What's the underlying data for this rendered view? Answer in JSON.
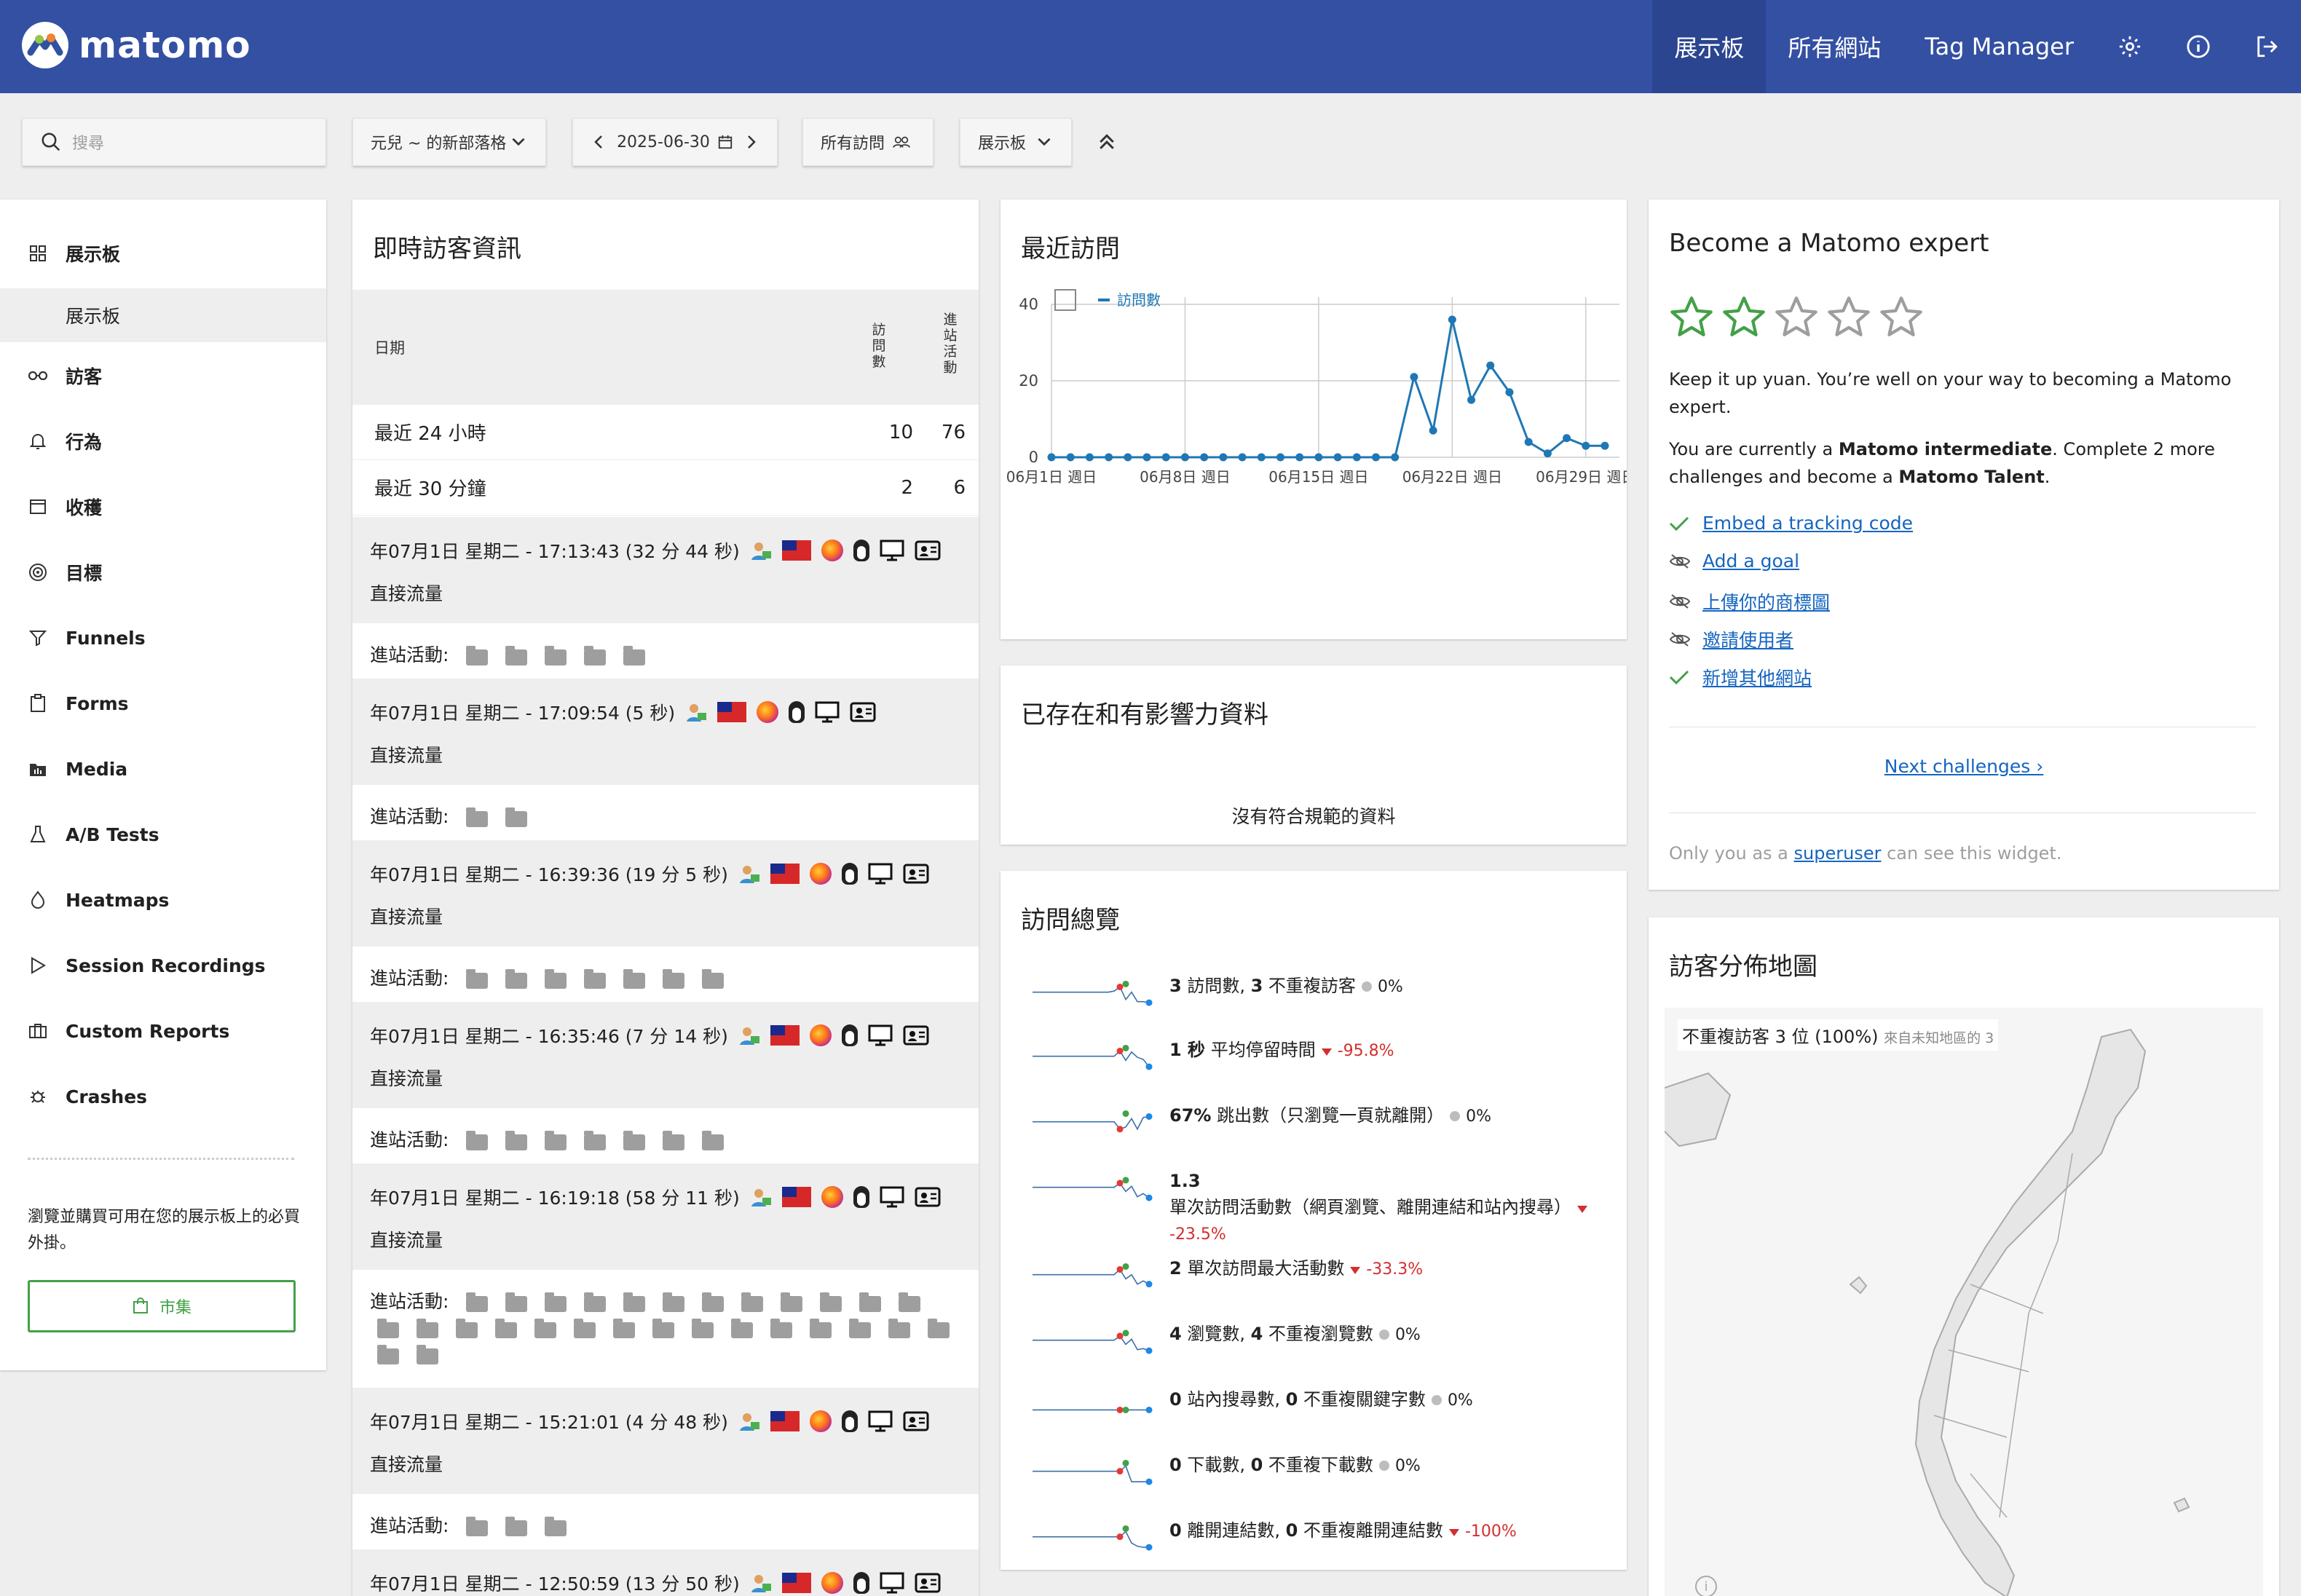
{
  "app": {
    "brand": "matomo"
  },
  "topnav": {
    "dashboard": "展示板",
    "all_websites": "所有網站",
    "tag_manager": "Tag Manager"
  },
  "controls": {
    "search_placeholder": "搜尋",
    "site": "元兒 ~ 的新部落格",
    "date": "2025-06-30",
    "segment": "所有訪問",
    "dashboard": "展示板"
  },
  "sidebar": {
    "items": [
      "展示板",
      "訪客",
      "行為",
      "收穫",
      "目標",
      "Funnels",
      "Forms",
      "Media",
      "A/B Tests",
      "Heatmaps",
      "Session Recordings",
      "Custom Reports",
      "Crashes"
    ],
    "sub": "展示板",
    "promo": "瀏覽並購買可用在您的展示板上的必買外掛。",
    "market": "市集"
  },
  "live": {
    "title": "即時訪客資訊",
    "col_date": "日期",
    "col_visits": "訪問數",
    "col_actions": "進站活動",
    "rows": [
      {
        "label": "最近 24 小時",
        "visits": "10",
        "actions": "76"
      },
      {
        "label": "最近 30 分鐘",
        "visits": "2",
        "actions": "6"
      }
    ],
    "source": "直接流量",
    "actions_label": "進站活動:",
    "visits": [
      {
        "time": "年07月1日 星期二 - 17:13:43 (32 分 44 秒)",
        "folders": 5
      },
      {
        "time": "年07月1日 星期二 - 17:09:54 (5 秒)",
        "folders": 2
      },
      {
        "time": "年07月1日 星期二 - 16:39:36 (19 分 5 秒)",
        "folders": 7
      },
      {
        "time": "年07月1日 星期二 - 16:35:46 (7 分 14 秒)",
        "folders": 7
      },
      {
        "time": "年07月1日 星期二 - 16:19:18 (58 分 11 秒)",
        "folders": 29
      },
      {
        "time": "年07月1日 星期二 - 15:21:01 (4 分 48 秒)",
        "folders": 3
      },
      {
        "time": "年07月1日 星期二 - 12:50:59 (13 分 50 秒)",
        "folders": 0
      }
    ]
  },
  "recent": {
    "title": "最近訪問",
    "legend": "訪問數",
    "chart_data": {
      "type": "line",
      "series": [
        {
          "name": "訪問數",
          "values": [
            0,
            0,
            0,
            0,
            0,
            0,
            0,
            0,
            0,
            0,
            0,
            0,
            0,
            0,
            0,
            0,
            0,
            0,
            0,
            21,
            7,
            36,
            15,
            24,
            17,
            4,
            1,
            5,
            3,
            3
          ]
        }
      ],
      "x_tick_labels": [
        "06月1日 週日",
        "06月8日 週日",
        "06月15日 週日",
        "06月22日 週日",
        "06月29日 週日"
      ],
      "y_ticks": [
        0,
        20,
        40
      ],
      "ylim": [
        0,
        40
      ],
      "grid": true,
      "legend": "top-left"
    }
  },
  "exist": {
    "title": "已存在和有影響力資料",
    "message": "沒有符合規範的資料"
  },
  "summary": {
    "title": "訪問總覽",
    "rows": [
      {
        "b1": "3",
        "t1": " 訪問數, ",
        "b2": "3",
        "t2": " 不重複訪客",
        "change": "0%",
        "neg": false
      },
      {
        "b1": "1 秒",
        "t1": " 平均停留時間",
        "b2": "",
        "t2": "",
        "change": "-95.8%",
        "neg": true
      },
      {
        "b1": "67%",
        "t1": " 跳出數（只瀏覽一頁就離開）",
        "b2": "",
        "t2": "",
        "change": "0%",
        "neg": false
      },
      {
        "b1": "1.3",
        "t1": " 單次訪問活動數（網頁瀏覽、離開連結和站內搜尋）",
        "b2": "",
        "t2": "",
        "change": "-23.5%",
        "neg": true
      },
      {
        "b1": "2",
        "t1": " 單次訪問最大活動數",
        "b2": "",
        "t2": "",
        "change": "-33.3%",
        "neg": true
      },
      {
        "b1": "4",
        "t1": " 瀏覽數, ",
        "b2": "4",
        "t2": " 不重複瀏覽數",
        "change": "0%",
        "neg": false
      },
      {
        "b1": "0",
        "t1": " 站內搜尋數, ",
        "b2": "0",
        "t2": " 不重複關鍵字數",
        "change": "0%",
        "neg": false
      },
      {
        "b1": "0",
        "t1": " 下載數, ",
        "b2": "0",
        "t2": " 不重複下載數",
        "change": "0%",
        "neg": false
      },
      {
        "b1": "0",
        "t1": " 離開連結數, ",
        "b2": "0",
        "t2": " 不重複離開連結數",
        "change": "-100%",
        "neg": true
      }
    ]
  },
  "expert": {
    "title": "Become a Matomo expert",
    "stars_filled": 2,
    "stars_total": 5,
    "p1": "Keep it up yuan. You’re well on your way to becoming a Matomo expert.",
    "p2a": "You are currently a ",
    "p2b": "Matomo intermediate",
    "p2c": ". Complete 2 more challenges and become a ",
    "p2d": "Matomo Talent",
    "p2e": ".",
    "challenges": [
      {
        "label": "Embed a tracking code",
        "done": true
      },
      {
        "label": "Add a goal",
        "done": false
      },
      {
        "label": "上傳你的商標圖",
        "done": false
      },
      {
        "label": "邀請使用者",
        "done": false
      },
      {
        "label": "新增其他網站",
        "done": true
      }
    ],
    "next": "Next challenges ›",
    "footer_a": "Only you as a ",
    "footer_link": "superuser",
    "footer_b": " can see this widget."
  },
  "map": {
    "title": "訪客分佈地圖",
    "label_main": "不重複訪客 3 位 (100%)",
    "label_small": "來自未知地區的 3"
  },
  "colors": {
    "header": "#3450a3",
    "header_active": "#2b4590",
    "line": "#1f77b4",
    "green": "#43a047",
    "negative": "#d32f2f"
  }
}
